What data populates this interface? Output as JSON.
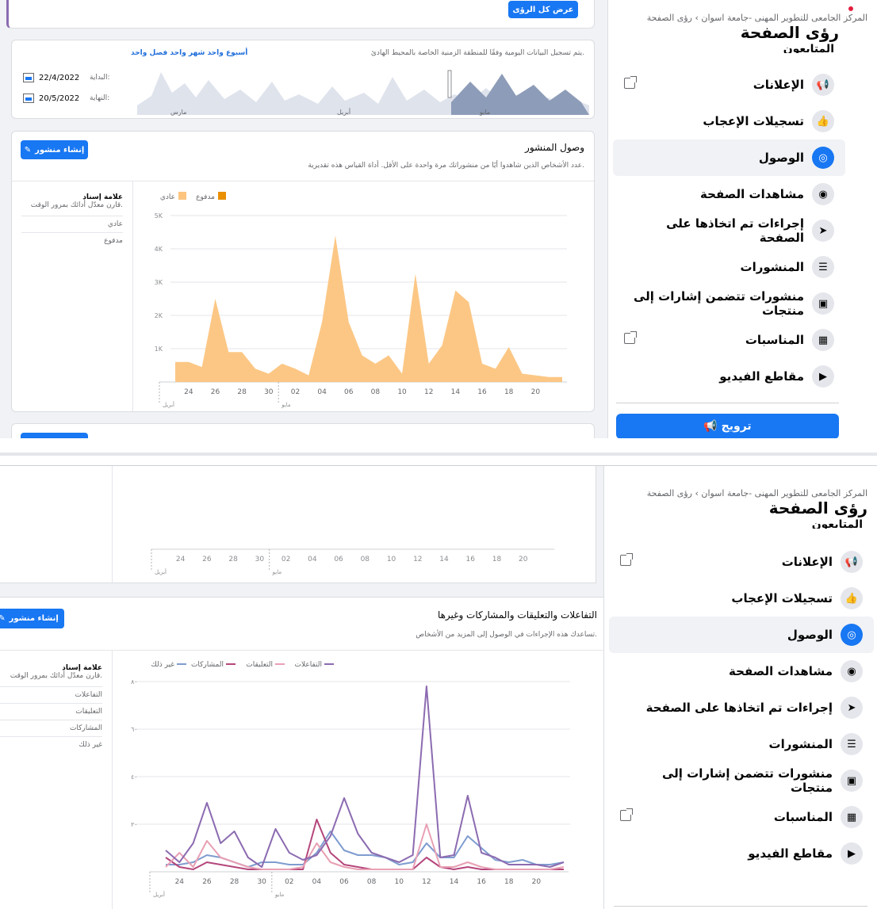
{
  "nav": {
    "breadcrumb": "المركز الجامعى للتطوير المهنى -جامعة اسوان › رؤى الصفحة",
    "title": "رؤى الصفحة",
    "partial_item": "المتابعون",
    "items": [
      {
        "label": "الإعلانات",
        "icon": "megaphone-icon",
        "glyph": "📢",
        "external": true
      },
      {
        "label": "تسجيلات الإعجاب",
        "icon": "thumbs-up-icon",
        "glyph": "👍",
        "external": false
      },
      {
        "label": "الوصول",
        "icon": "broadcast-icon",
        "glyph": "◎",
        "external": false,
        "active": true
      },
      {
        "label": "مشاهدات الصفحة",
        "icon": "eye-icon",
        "glyph": "◉",
        "external": false
      },
      {
        "label": "إجراءات تم اتخاذها على الصفحة",
        "icon": "cursor-icon",
        "glyph": "➤",
        "external": false
      },
      {
        "label": "المنشورات",
        "icon": "posts-icon",
        "glyph": "☰",
        "external": false
      },
      {
        "label": "منشورات تتضمن إشارات إلى منتجات",
        "icon": "shopping-tag-icon",
        "glyph": "▣",
        "external": false
      },
      {
        "label": "المناسبات",
        "icon": "calendar-icon",
        "glyph": "▦",
        "external": true
      },
      {
        "label": "مقاطع الفيديو",
        "icon": "video-icon",
        "glyph": "▶",
        "external": false
      }
    ],
    "promote_label": "ترويج"
  },
  "top": {
    "view_all_label": "عرض كل الرؤى",
    "range_links": "أسبوع واحد  شهر واحد  فصل واحد",
    "timezone_note": "يتم تسجيل البيانات اليومية وفقًا للمنطقة الزمنية الخاصة بالمحيط الهادئ.",
    "start_label": "البداية:",
    "start_date": "22/4/2022",
    "end_label": "النهاية:",
    "end_date": "20/5/2022",
    "month_labels": [
      "مارس",
      "أبريل",
      "مايو"
    ]
  },
  "reach": {
    "title": "وصول المنشور",
    "subtitle": "عدد الأشخاص الذين شاهدوا أيًا من منشوراتك مرة واحدة على الأقل. أداة القياس هذه تقديرية.",
    "create_post_label": "إنشاء منشور",
    "side_heading": "علامة إسناد",
    "side_sub": "قارن معدّل أدائك بمرور الوقت.",
    "side_rows": [
      "عادي",
      "مدفوع"
    ]
  },
  "engage": {
    "title": "التفاعلات والتعليقات والمشاركات وغيرها",
    "subtitle": "تساعدك هذه الإجراءات في الوصول إلى المزيد من الأشخاص.",
    "create_post_label": "إنشاء منشور",
    "side_heading": "علامة إسناد",
    "side_sub": "قارن معدّل أدائك بمرور الوقت.",
    "side_rows": [
      "التفاعلات",
      "التعليقات",
      "المشاركات",
      "غير ذلك"
    ]
  },
  "chart_data": [
    {
      "type": "area",
      "title": "وصول المنشور",
      "x": [
        "23",
        "24",
        "25",
        "26",
        "27",
        "28",
        "29",
        "30",
        "01",
        "02",
        "03",
        "04",
        "05",
        "06",
        "07",
        "08",
        "09",
        "10",
        "11",
        "12",
        "13",
        "14",
        "15",
        "16",
        "17",
        "18",
        "19",
        "20",
        "21",
        "22"
      ],
      "x_tick_labels": [
        "24",
        "26",
        "28",
        "30",
        "02",
        "04",
        "06",
        "08",
        "10",
        "12",
        "14",
        "16",
        "18",
        "20"
      ],
      "x_group_labels": [
        "أبريل",
        "مايو"
      ],
      "ylim": [
        0,
        5000
      ],
      "y_ticks": [
        "5K",
        "4K",
        "3K",
        "2K",
        "1K"
      ],
      "series": [
        {
          "name": "عادي",
          "color": "#fcc47e",
          "values": [
            600,
            600,
            450,
            2500,
            900,
            900,
            400,
            250,
            550,
            400,
            200,
            1800,
            4400,
            1800,
            800,
            550,
            800,
            250,
            3250,
            550,
            1100,
            2750,
            2400,
            550,
            400,
            1050,
            250,
            200,
            150,
            150
          ]
        },
        {
          "name": "مدفوع",
          "color": "#e98f00",
          "values": [
            0,
            0,
            0,
            0,
            0,
            0,
            0,
            0,
            0,
            0,
            0,
            0,
            0,
            0,
            0,
            0,
            0,
            0,
            0,
            0,
            0,
            0,
            0,
            0,
            0,
            0,
            0,
            0,
            0,
            0
          ]
        }
      ],
      "legend": "top-right"
    },
    {
      "type": "line",
      "title": "التفاعلات والتعليقات والمشاركات وغيرها",
      "x": [
        "23",
        "24",
        "25",
        "26",
        "27",
        "28",
        "29",
        "30",
        "01",
        "02",
        "03",
        "04",
        "05",
        "06",
        "07",
        "08",
        "09",
        "10",
        "11",
        "12",
        "13",
        "14",
        "15",
        "16",
        "17",
        "18",
        "19",
        "20",
        "21",
        "22"
      ],
      "x_tick_labels": [
        "24",
        "26",
        "28",
        "30",
        "02",
        "04",
        "06",
        "08",
        "10",
        "12",
        "14",
        "16",
        "18",
        "20"
      ],
      "x_group_labels": [
        "أبريل",
        "مايو"
      ],
      "ylim": [
        0,
        80
      ],
      "y_ticks": [
        "٨٠",
        "٦٠",
        "٤٠",
        "٢٠"
      ],
      "series": [
        {
          "name": "التفاعلات",
          "color": "#8c6bb1",
          "values": [
            9,
            4,
            12,
            29,
            12,
            17,
            6,
            2,
            18,
            8,
            5,
            7,
            15,
            31,
            16,
            8,
            6,
            4,
            7,
            78,
            6,
            7,
            32,
            8,
            6,
            3,
            3,
            3,
            2,
            4
          ]
        },
        {
          "name": "التعليقات",
          "color": "#e8a0b4",
          "values": [
            2,
            8,
            2,
            13,
            6,
            4,
            2,
            1,
            1,
            1,
            2,
            12,
            4,
            2,
            1,
            1,
            1,
            1,
            1,
            20,
            2,
            2,
            4,
            2,
            1,
            1,
            1,
            1,
            1,
            2
          ]
        },
        {
          "name": "المشاركات",
          "color": "#b5467b",
          "values": [
            6,
            2,
            1,
            4,
            3,
            2,
            1,
            1,
            1,
            1,
            1,
            22,
            8,
            3,
            2,
            1,
            1,
            1,
            1,
            6,
            2,
            1,
            2,
            1,
            1,
            1,
            1,
            1,
            1,
            1
          ]
        },
        {
          "name": "غير ذلك",
          "color": "#7f9ccf",
          "values": [
            3,
            3,
            4,
            7,
            6,
            4,
            2,
            4,
            4,
            3,
            3,
            8,
            17,
            9,
            7,
            7,
            6,
            3,
            4,
            12,
            6,
            6,
            15,
            10,
            5,
            4,
            5,
            3,
            3,
            4
          ]
        }
      ],
      "legend": "top-right"
    }
  ]
}
